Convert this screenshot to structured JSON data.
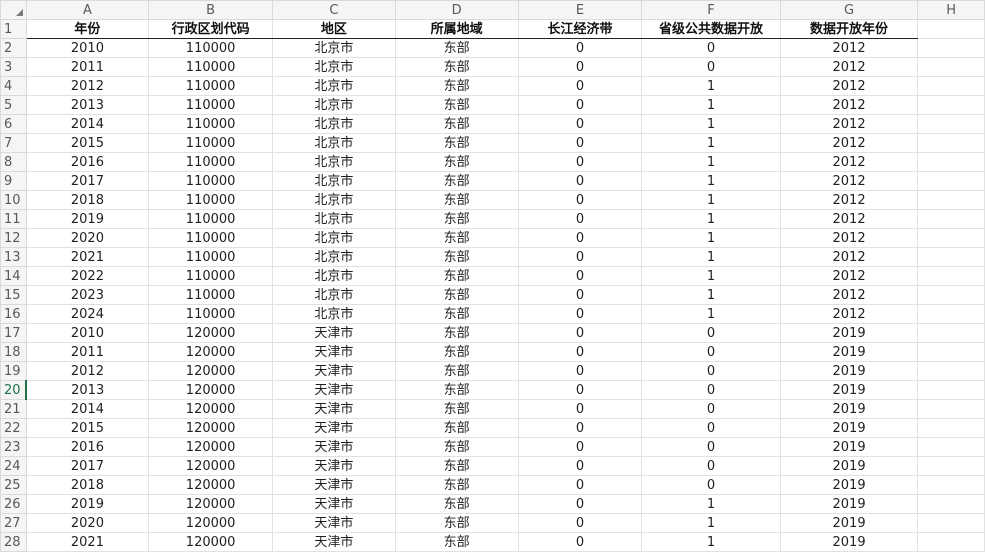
{
  "sheet": {
    "columns": [
      "A",
      "B",
      "C",
      "D",
      "E",
      "F",
      "G",
      "H"
    ],
    "rows": [
      {
        "n": "1",
        "cells": [
          "年份",
          "行政区划代码",
          "地区",
          "所属地域",
          "长江经济带",
          "省级公共数据开放",
          "数据开放年份"
        ]
      },
      {
        "n": "2",
        "cells": [
          "2010",
          "110000",
          "北京市",
          "东部",
          "0",
          "0",
          "2012"
        ]
      },
      {
        "n": "3",
        "cells": [
          "2011",
          "110000",
          "北京市",
          "东部",
          "0",
          "0",
          "2012"
        ]
      },
      {
        "n": "4",
        "cells": [
          "2012",
          "110000",
          "北京市",
          "东部",
          "0",
          "1",
          "2012"
        ]
      },
      {
        "n": "5",
        "cells": [
          "2013",
          "110000",
          "北京市",
          "东部",
          "0",
          "1",
          "2012"
        ]
      },
      {
        "n": "6",
        "cells": [
          "2014",
          "110000",
          "北京市",
          "东部",
          "0",
          "1",
          "2012"
        ]
      },
      {
        "n": "7",
        "cells": [
          "2015",
          "110000",
          "北京市",
          "东部",
          "0",
          "1",
          "2012"
        ]
      },
      {
        "n": "8",
        "cells": [
          "2016",
          "110000",
          "北京市",
          "东部",
          "0",
          "1",
          "2012"
        ]
      },
      {
        "n": "9",
        "cells": [
          "2017",
          "110000",
          "北京市",
          "东部",
          "0",
          "1",
          "2012"
        ]
      },
      {
        "n": "10",
        "cells": [
          "2018",
          "110000",
          "北京市",
          "东部",
          "0",
          "1",
          "2012"
        ]
      },
      {
        "n": "11",
        "cells": [
          "2019",
          "110000",
          "北京市",
          "东部",
          "0",
          "1",
          "2012"
        ]
      },
      {
        "n": "12",
        "cells": [
          "2020",
          "110000",
          "北京市",
          "东部",
          "0",
          "1",
          "2012"
        ]
      },
      {
        "n": "13",
        "cells": [
          "2021",
          "110000",
          "北京市",
          "东部",
          "0",
          "1",
          "2012"
        ]
      },
      {
        "n": "14",
        "cells": [
          "2022",
          "110000",
          "北京市",
          "东部",
          "0",
          "1",
          "2012"
        ]
      },
      {
        "n": "15",
        "cells": [
          "2023",
          "110000",
          "北京市",
          "东部",
          "0",
          "1",
          "2012"
        ]
      },
      {
        "n": "16",
        "cells": [
          "2024",
          "110000",
          "北京市",
          "东部",
          "0",
          "1",
          "2012"
        ]
      },
      {
        "n": "17",
        "cells": [
          "2010",
          "120000",
          "天津市",
          "东部",
          "0",
          "0",
          "2019"
        ]
      },
      {
        "n": "18",
        "cells": [
          "2011",
          "120000",
          "天津市",
          "东部",
          "0",
          "0",
          "2019"
        ]
      },
      {
        "n": "19",
        "cells": [
          "2012",
          "120000",
          "天津市",
          "东部",
          "0",
          "0",
          "2019"
        ]
      },
      {
        "n": "20",
        "cells": [
          "2013",
          "120000",
          "天津市",
          "东部",
          "0",
          "0",
          "2019"
        ]
      },
      {
        "n": "21",
        "cells": [
          "2014",
          "120000",
          "天津市",
          "东部",
          "0",
          "0",
          "2019"
        ]
      },
      {
        "n": "22",
        "cells": [
          "2015",
          "120000",
          "天津市",
          "东部",
          "0",
          "0",
          "2019"
        ]
      },
      {
        "n": "23",
        "cells": [
          "2016",
          "120000",
          "天津市",
          "东部",
          "0",
          "0",
          "2019"
        ]
      },
      {
        "n": "24",
        "cells": [
          "2017",
          "120000",
          "天津市",
          "东部",
          "0",
          "0",
          "2019"
        ]
      },
      {
        "n": "25",
        "cells": [
          "2018",
          "120000",
          "天津市",
          "东部",
          "0",
          "0",
          "2019"
        ]
      },
      {
        "n": "26",
        "cells": [
          "2019",
          "120000",
          "天津市",
          "东部",
          "0",
          "1",
          "2019"
        ]
      },
      {
        "n": "27",
        "cells": [
          "2020",
          "120000",
          "天津市",
          "东部",
          "0",
          "1",
          "2019"
        ]
      },
      {
        "n": "28",
        "cells": [
          "2021",
          "120000",
          "天津市",
          "东部",
          "0",
          "1",
          "2019"
        ]
      }
    ],
    "active_row": "20"
  }
}
